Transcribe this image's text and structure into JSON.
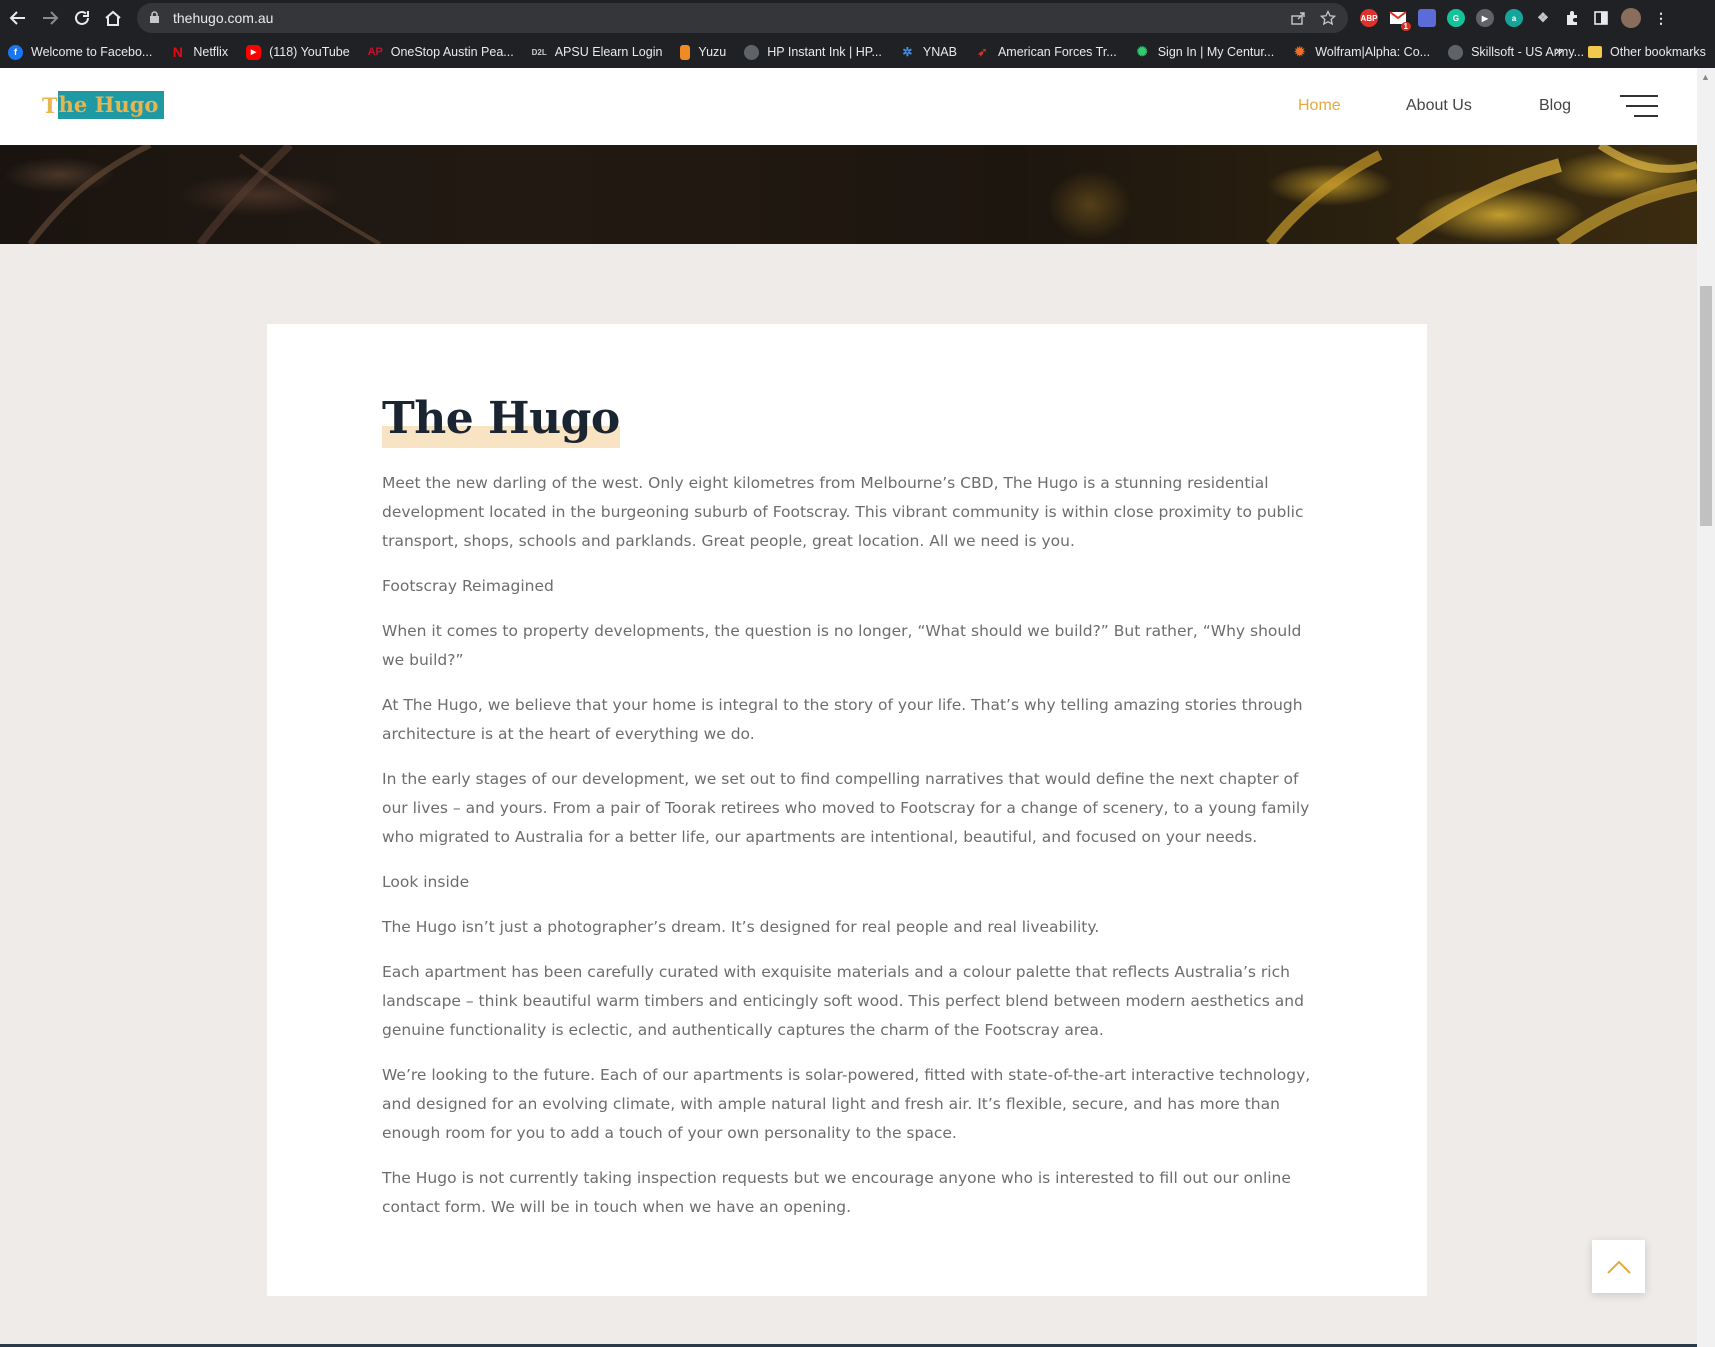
{
  "browser": {
    "url": "thehugo.com.au",
    "bookmarks": [
      {
        "label": "Welcome to Facebo...",
        "icon": "facebook-icon",
        "color": "#1877f2"
      },
      {
        "label": "Netflix",
        "icon": "netflix-icon",
        "color": "#e50914"
      },
      {
        "label": "(118) YouTube",
        "icon": "youtube-icon",
        "color": "#ff0000"
      },
      {
        "label": "OneStop Austin Pea...",
        "icon": "onestop-icon",
        "color": "#c8102e"
      },
      {
        "label": "APSU Elearn Login",
        "icon": "d2l-icon",
        "color": "#555555"
      },
      {
        "label": "Yuzu",
        "icon": "yuzu-icon",
        "color": "#f08a24"
      },
      {
        "label": "HP Instant Ink | HP...",
        "icon": "globe-icon",
        "color": "#777777"
      },
      {
        "label": "YNAB",
        "icon": "ynab-icon",
        "color": "#4a90e2"
      },
      {
        "label": "American Forces Tr...",
        "icon": "aft-icon",
        "color": "#c0392b"
      },
      {
        "label": "Sign In | My Centur...",
        "icon": "century-icon",
        "color": "#2ecc71"
      },
      {
        "label": "Wolfram|Alpha: Co...",
        "icon": "wolfram-icon",
        "color": "#f37021"
      },
      {
        "label": "Skillsoft - US Army...",
        "icon": "globe-icon",
        "color": "#777777"
      }
    ],
    "more_label": "»",
    "other_bookmarks": "Other bookmarks"
  },
  "site": {
    "logo": {
      "part1": "T",
      "part2": "he Hugo"
    },
    "nav": {
      "home": "Home",
      "about": "About Us",
      "blog": "Blog"
    },
    "accent_color": "#e6a940"
  },
  "article": {
    "title": "The Hugo",
    "paragraphs": [
      "Meet the new darling of the west. Only eight kilometres from Melbourne’s CBD, The Hugo is a stunning residential development located in the burgeoning suburb of Footscray. This vibrant community is within close proximity to public transport, shops, schools and parklands. Great people, great location. All we need is you.",
      "Footscray Reimagined",
      "When it comes to property developments, the question is no longer, “What should we build?” But rather, “Why should we build?”",
      "At The Hugo, we believe that your home is integral to the story of your life. That’s why telling amazing stories through architecture is at the heart of everything we do.",
      "In the early stages of our development, we set out to find compelling narratives that would define the next chapter of our lives – and yours. From a pair of Toorak retirees who moved to Footscray for a change of scenery, to a young family who migrated to Australia for a better life, our apartments are intentional, beautiful, and focused on your needs.",
      "Look inside",
      "The Hugo isn’t just a photographer’s dream. It’s designed for real people and real liveability.",
      "Each apartment has been carefully curated with exquisite materials and a colour palette that reflects Australia’s rich landscape – think beautiful warm timbers and enticingly soft wood. This perfect blend between modern aesthetics and genuine functionality is eclectic, and authentically captures the charm of the Footscray area.",
      "We’re looking to the future. Each of our apartments is solar-powered, fitted with state-of-the-art interactive technology, and designed for an evolving climate, with ample natural light and fresh air. It’s flexible, secure, and has more than enough room for you to add a touch of your own personality to the space.",
      "The Hugo is not currently taking inspection requests but we encourage anyone who is interested to fill out our online contact form. We will be in touch when we have an opening."
    ]
  }
}
